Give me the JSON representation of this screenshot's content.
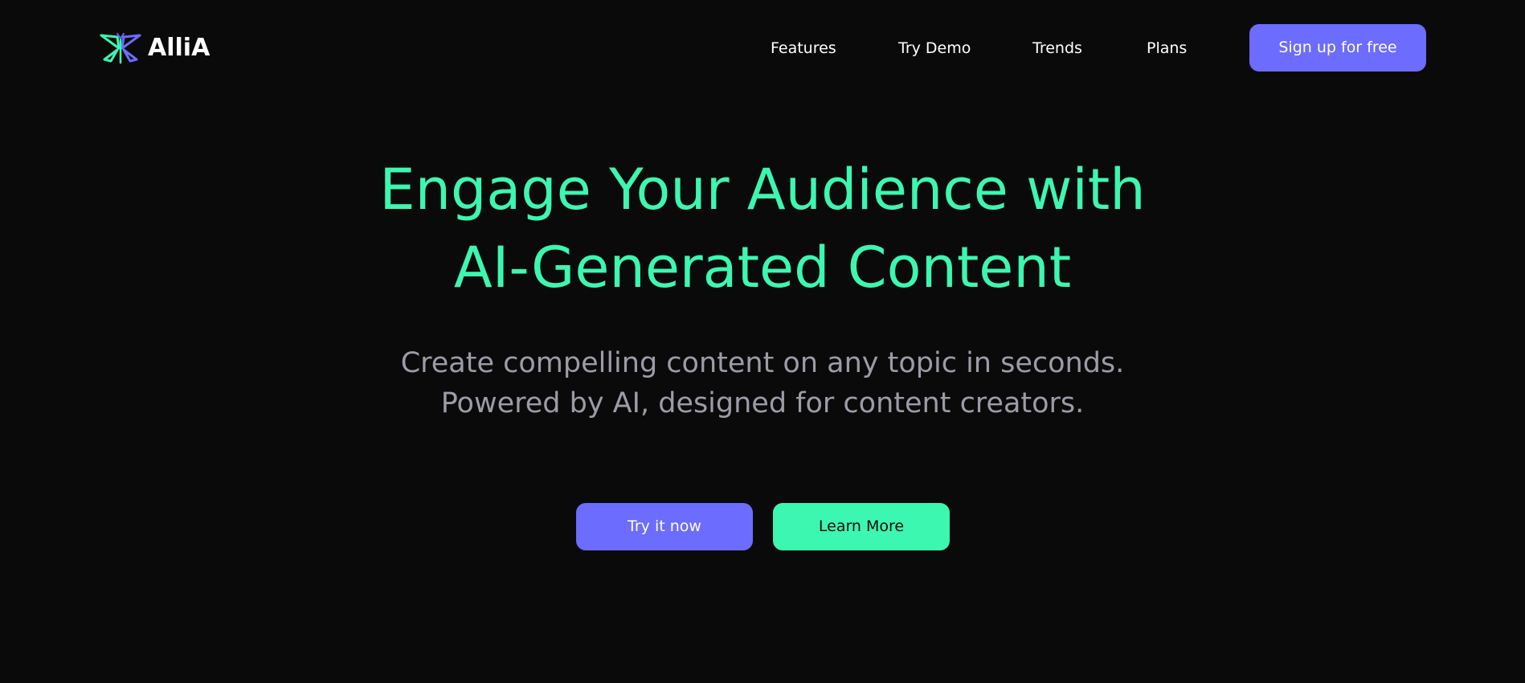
{
  "brand": {
    "name": "AlliA",
    "logo_icon": "butterfly-logo-icon",
    "colors": {
      "green": "#3cf7b0",
      "purple": "#6c6cff",
      "background": "#0a0a0a"
    }
  },
  "nav": {
    "items": [
      {
        "label": "Features"
      },
      {
        "label": "Try Demo"
      },
      {
        "label": "Trends"
      },
      {
        "label": "Plans"
      }
    ],
    "signup_label": "Sign up for free"
  },
  "hero": {
    "title_lines": [
      "Engage Your Audience with",
      "AI-Generated Content"
    ],
    "subtitle_lines": [
      "Create compelling content on any topic in seconds.",
      "Powered by AI, designed for content creators."
    ],
    "try_label": "Try it now",
    "learn_label": "Learn More"
  }
}
